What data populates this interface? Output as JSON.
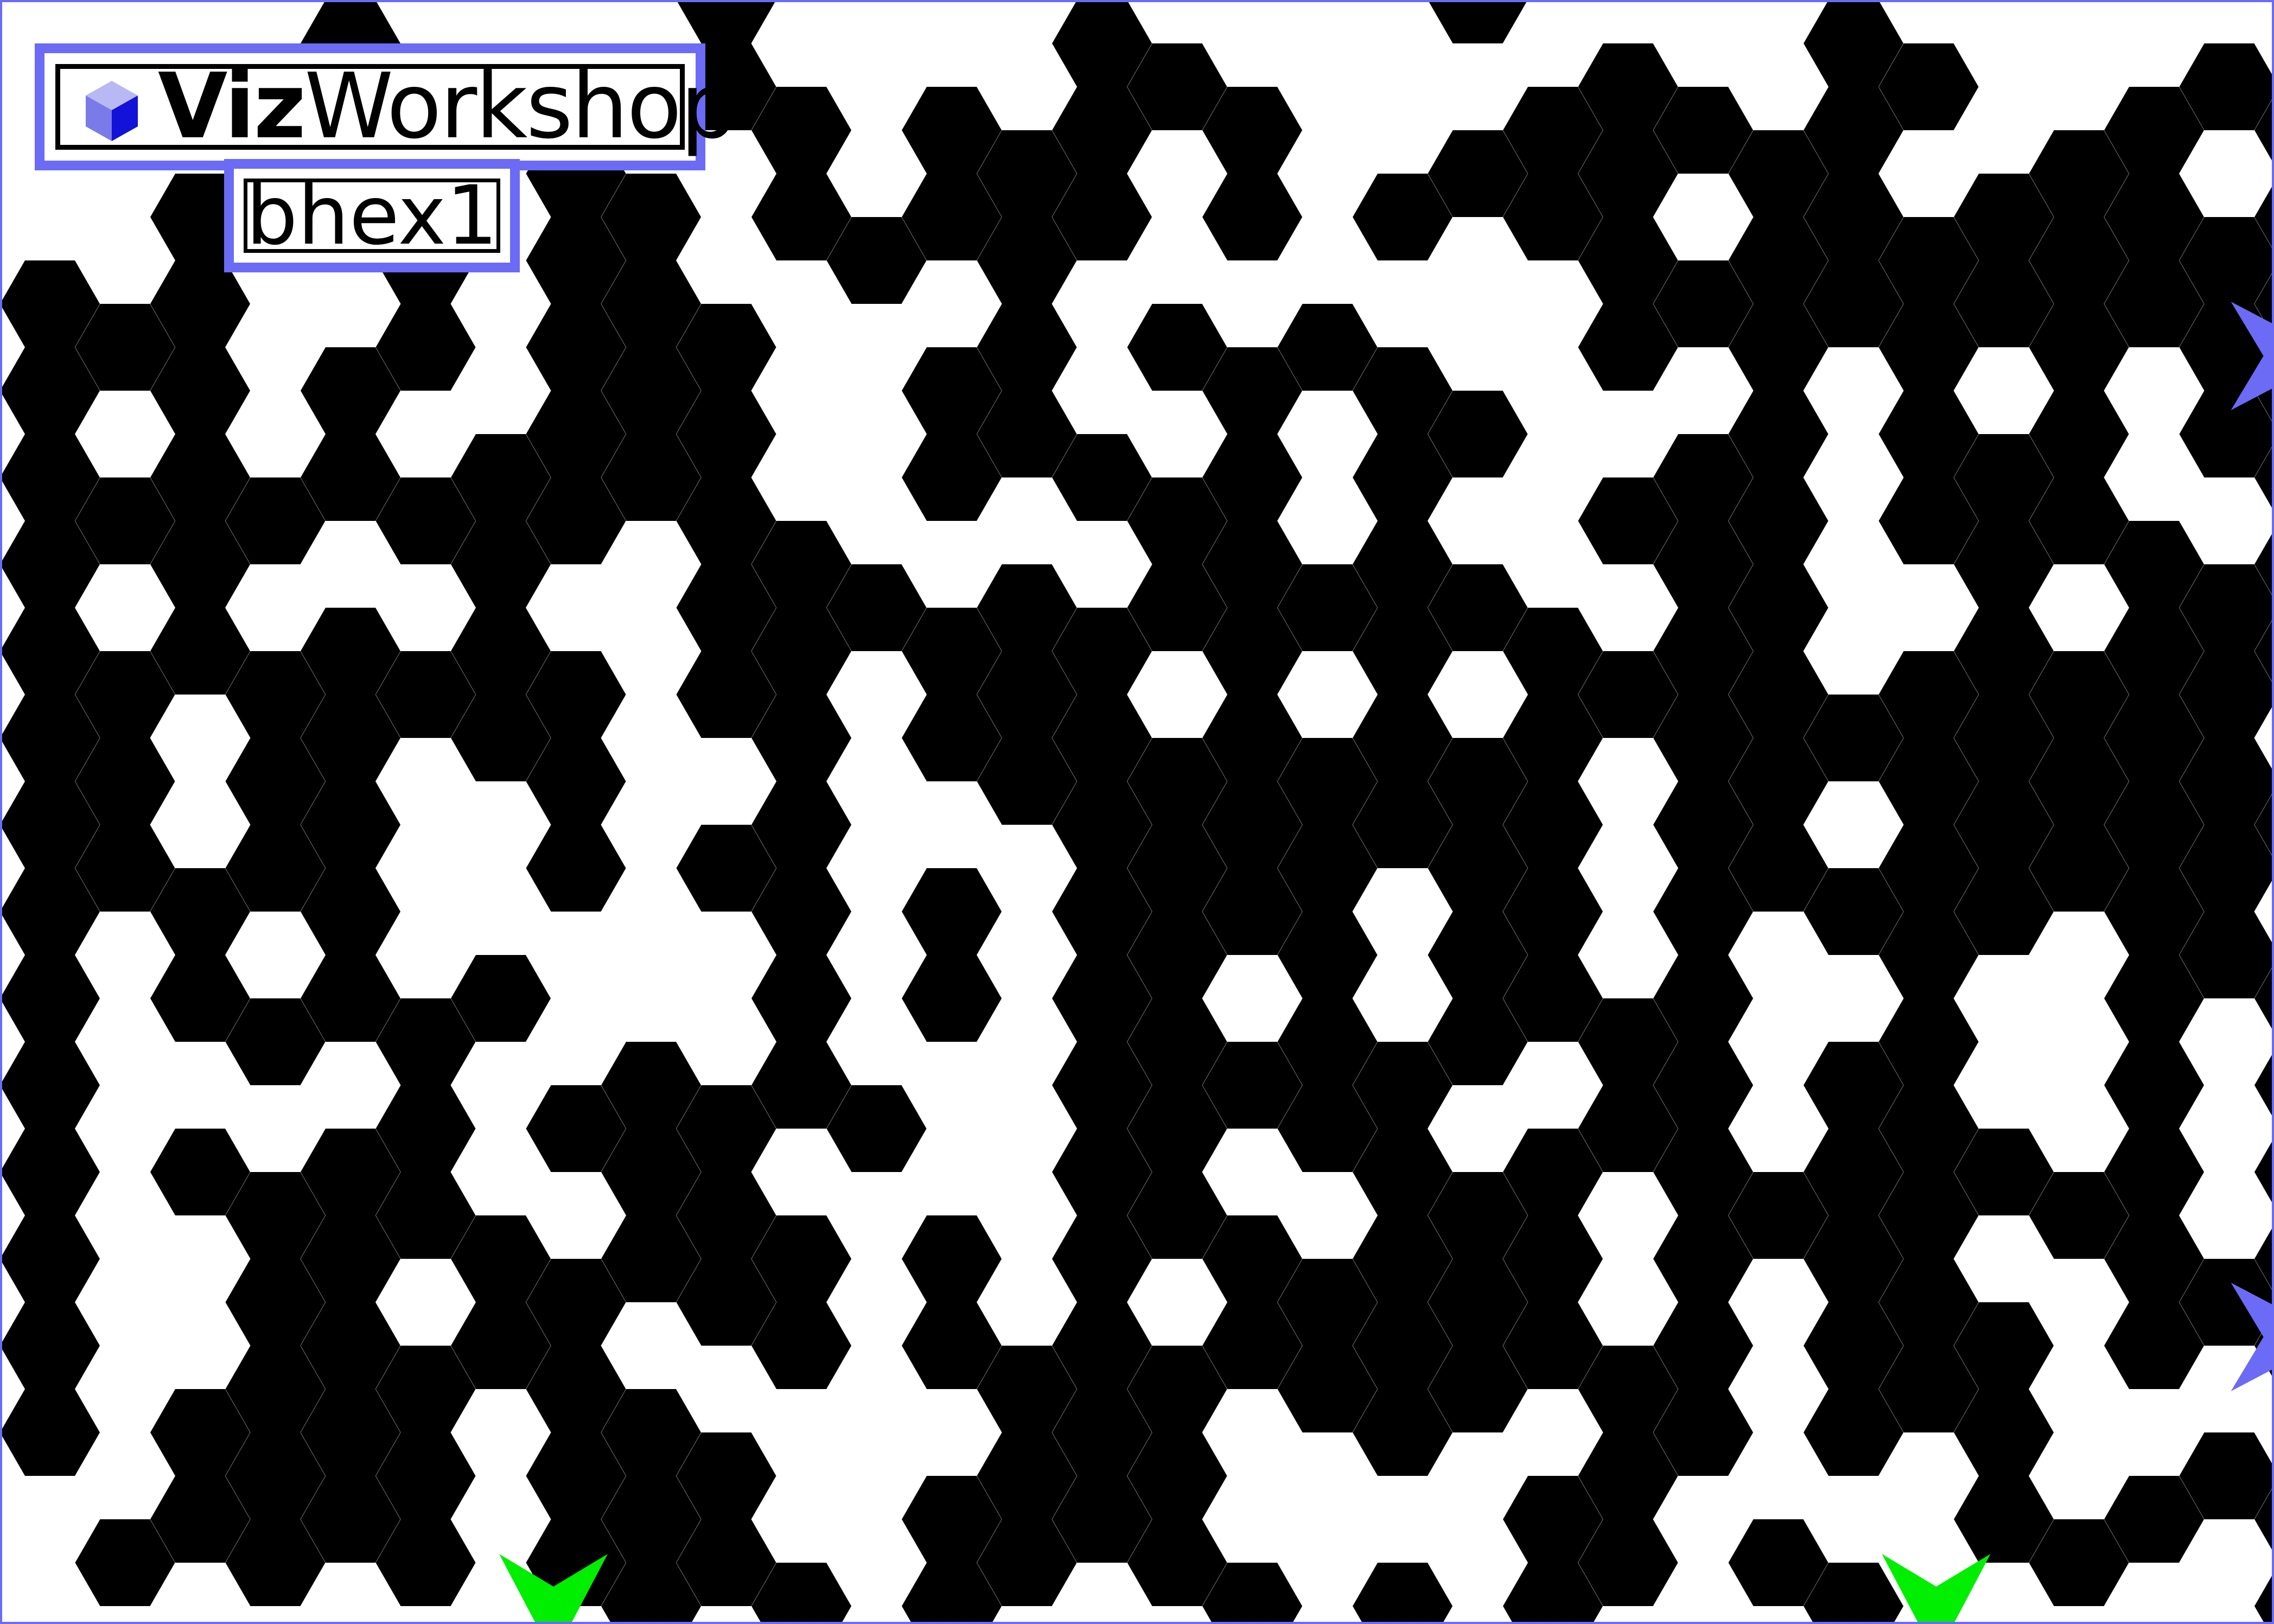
{
  "app": {
    "brand_bold": "Viz",
    "brand_rest": "Workshop",
    "level_name": "bhex1"
  },
  "board": {
    "cols": 31,
    "rows": 19,
    "filled": [
      "0000100001000010000100001000000",
      "0000000001101011100011101100111",
      "0010010110101110101111011011101",
      "1010010110010100000001111111111",
      "1110110111001101111001010101011",
      "1010101111001110101100110111011",
      "1111011101100001101001110111101",
      "1010101001111111111110110010111",
      "1101111101101110101011111111110",
      "1101100100100111111110110111111",
      "1111100101101011110110111111110",
      "1010101000101011010110100100111",
      "1001010010100011111101101100101",
      "1010110111010011011011101110101",
      "1001111011101011101110111101101",
      "1001101101101010111110101110111",
      "1011110110000111011101101110000",
      "0011110111001111000011000010111",
      "0101010111101101101011011001001"
    ],
    "colors": {
      "wall": "#000000",
      "open": "#ffffff",
      "frame": "#6b6bf5"
    }
  },
  "markers": [
    {
      "type": "exit-arrow",
      "color": "#6b6bf5",
      "col": 29.6,
      "row": 3.6,
      "direction": "right"
    },
    {
      "type": "exit-arrow",
      "color": "#6b6bf5",
      "col": 29.6,
      "row": 14.9,
      "direction": "right"
    },
    {
      "type": "entry-arrow",
      "color": "#00ee00",
      "col": 6.7,
      "row": 17.9,
      "direction": "down"
    },
    {
      "type": "entry-arrow",
      "color": "#00ee00",
      "col": 25.1,
      "row": 17.9,
      "direction": "down"
    }
  ],
  "icons": {
    "logo": "cube-logo-icon"
  }
}
